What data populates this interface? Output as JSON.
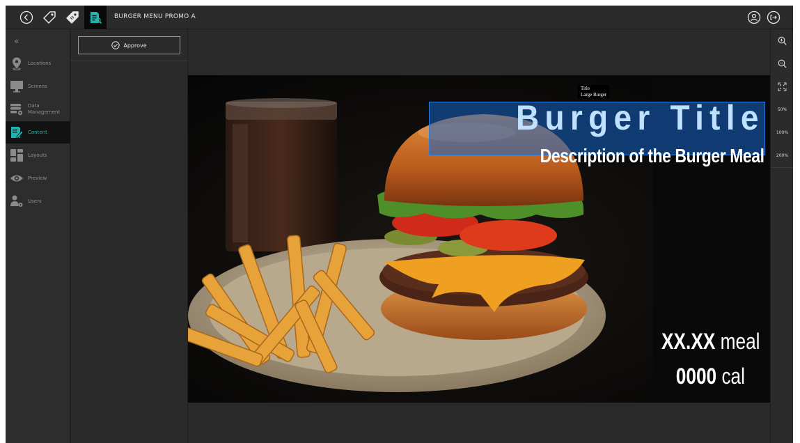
{
  "header": {
    "title": "BURGER MENU PROMO A",
    "icons": [
      "back-icon",
      "tag-icon",
      "tag-filled-icon",
      "content-doc-icon",
      "account-icon",
      "logout-icon"
    ]
  },
  "sidebar": {
    "collapse_glyph": "«",
    "items": [
      {
        "label": "Locations",
        "icon": "location-pin-icon"
      },
      {
        "label": "Screens",
        "icon": "monitor-icon"
      },
      {
        "label": "Data Management",
        "icon": "database-gear-icon"
      },
      {
        "label": "Content",
        "icon": "content-edit-icon",
        "active": true
      },
      {
        "label": "Layouts",
        "icon": "layouts-icon"
      },
      {
        "label": "Preview",
        "icon": "eye-icon"
      },
      {
        "label": "Users",
        "icon": "user-gear-icon"
      }
    ]
  },
  "panel": {
    "approve_label": "Approve"
  },
  "canvas": {
    "tooltip_line1": "Title",
    "tooltip_line2": "Large Burger",
    "title": "Burger Title",
    "description": "Description of the Burger Meal",
    "price_value": "XX.XX",
    "price_unit": "meal",
    "cal_value": "0000",
    "cal_unit": "cal"
  },
  "tools": {
    "zoom_in": "zoom-in-icon",
    "zoom_out": "zoom-out-icon",
    "fit": "fit-screen-icon",
    "zoom_50": "50%",
    "zoom_100": "100%",
    "zoom_200": "200%"
  },
  "colors": {
    "accent": "#21b3b0",
    "selection": "#1464c8",
    "title_text": "#bfe0ff"
  }
}
